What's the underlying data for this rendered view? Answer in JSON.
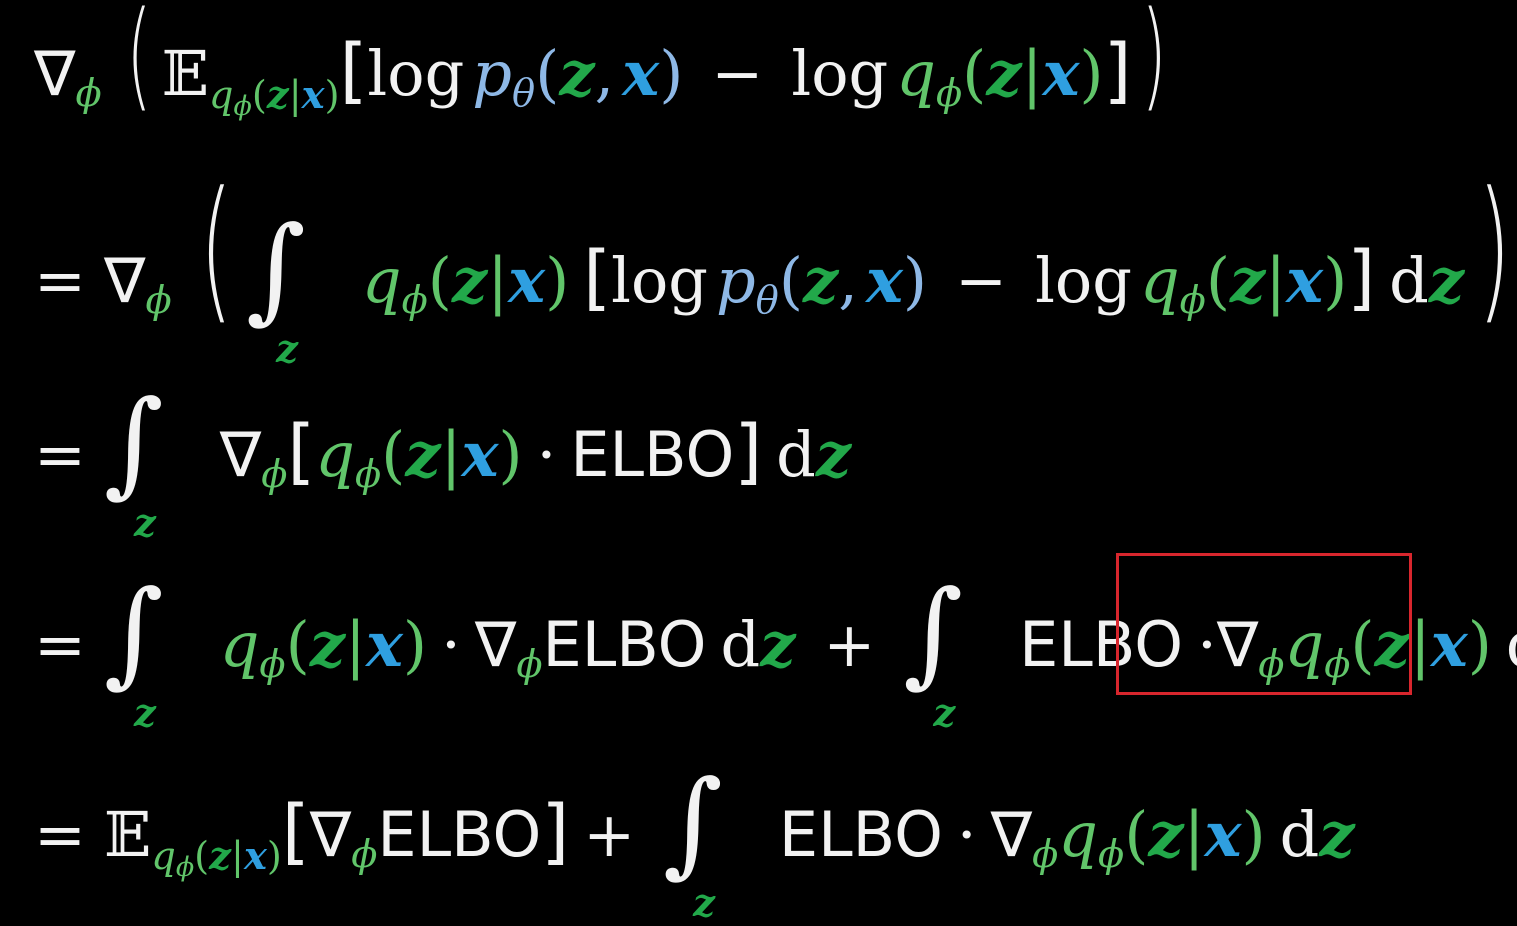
{
  "symbols": {
    "nabla": "∇",
    "phi": "ϕ",
    "theta": "θ",
    "E": "𝔼",
    "integral": "∫",
    "equals": "=",
    "minus": "−",
    "plus": "+",
    "cdot": "·",
    "log": "log",
    "p": "p",
    "q": "q",
    "z": "z",
    "x": "x",
    "d": "d",
    "bar": "|",
    "comma": ",",
    "lparen": "(",
    "rparen": ")",
    "lbracket": "[",
    "rbracket": "]",
    "elbo": "ELBO"
  },
  "colors": {
    "background": "#000000",
    "white": "#f2f2f2",
    "light_green": "#61c56a",
    "dark_green": "#22a84a",
    "blue": "#2f9fe0",
    "light_blue": "#8eb8e6",
    "highlight_box": "#d8262d"
  }
}
